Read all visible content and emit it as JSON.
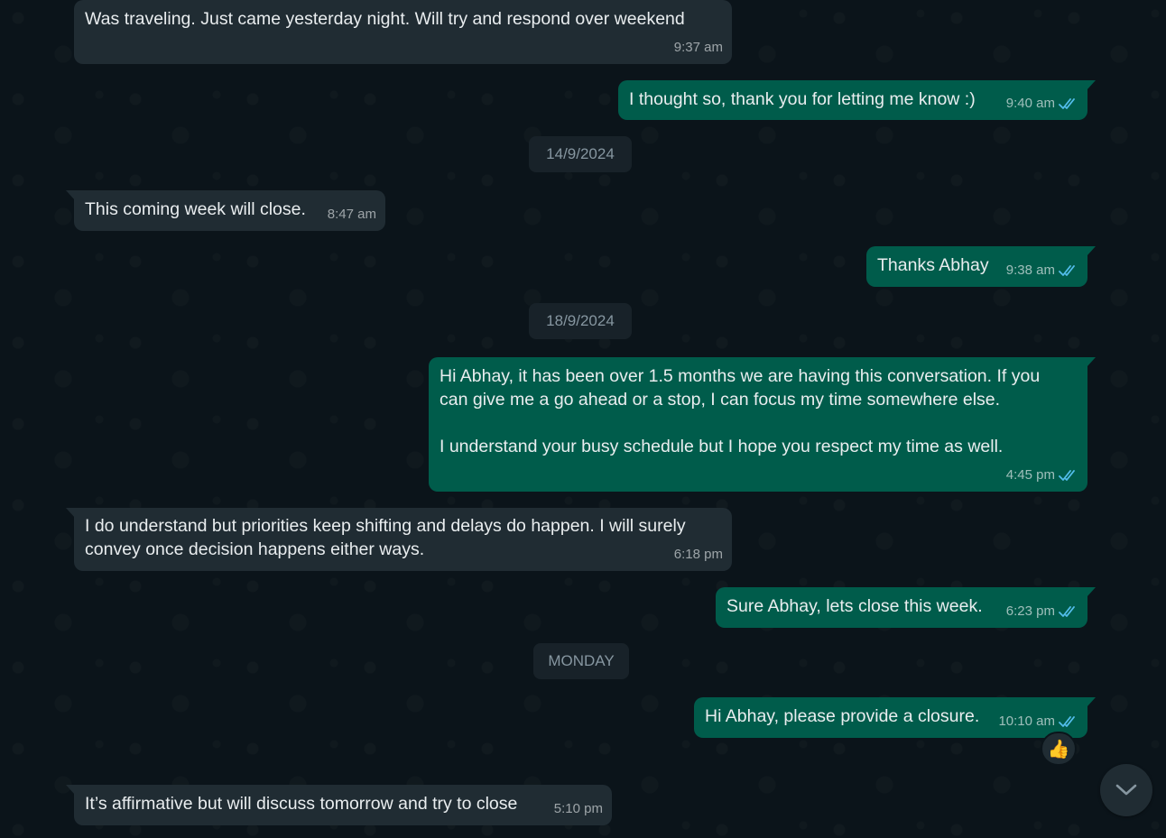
{
  "messages": [
    {
      "text": "Was traveling. Just came yesterday night. Will try and respond over weekend",
      "time": "9:37 am"
    },
    {
      "text": "I thought so, thank you for letting me know :)",
      "time": "9:40 am"
    },
    {
      "text": "This coming week will close.",
      "time": "8:47 am"
    },
    {
      "text": "Thanks Abhay",
      "time": "9:38 am"
    },
    {
      "text": "Hi Abhay, it has been over 1.5 months we are having this conversation. If you\ncan give me a go ahead or a stop, I can focus my time somewhere else.\n\nI understand your busy schedule but I hope you respect my time as well.",
      "time": "4:45 pm"
    },
    {
      "text": "I do understand but priorities keep shifting and delays do happen. I will surely\nconvey once decision happens either ways.",
      "time": "6:18 pm"
    },
    {
      "text": "Sure Abhay, lets close this week.",
      "time": "6:23 pm"
    },
    {
      "text": "Hi Abhay, please provide a closure.",
      "time": "10:10 am"
    },
    {
      "text": "It’s affirmative but will discuss tomorrow and try to close",
      "time": "5:10 pm"
    }
  ],
  "dates": [
    "14/9/2024",
    "18/9/2024",
    "MONDAY"
  ],
  "reaction": {
    "emoji": "👍"
  },
  "icons": {
    "read_receipt": "double-check-icon",
    "scroll": "chevron-down-icon"
  },
  "colors": {
    "read_tick": "#53bdeb",
    "incoming": "#202c33",
    "outgoing": "#005c4b",
    "background": "#0b141a"
  }
}
